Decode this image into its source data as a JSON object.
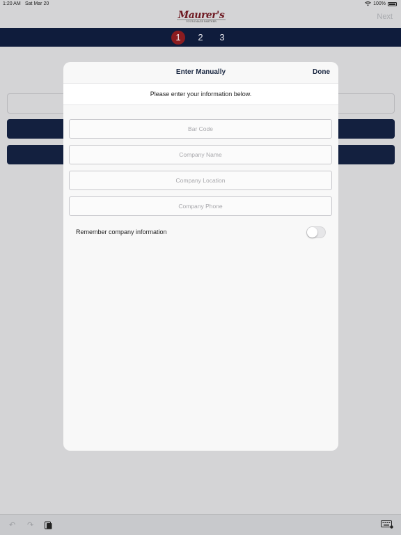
{
  "status_bar": {
    "time": "1:20 AM",
    "date": "Sat Mar 20",
    "battery": "100%"
  },
  "nav": {
    "logo_text": "Maurer's",
    "logo_tagline": "YOUR IMAGE PARTNER",
    "next_label": "Next"
  },
  "steps": [
    {
      "label": "1",
      "active": true
    },
    {
      "label": "2",
      "active": false
    },
    {
      "label": "3",
      "active": false
    }
  ],
  "modal": {
    "title": "Enter Manually",
    "done_label": "Done",
    "instructions": "Please enter your information below.",
    "fields": [
      {
        "placeholder": "Bar Code",
        "value": ""
      },
      {
        "placeholder": "Company Name",
        "value": ""
      },
      {
        "placeholder": "Company Location",
        "value": ""
      },
      {
        "placeholder": "Company Phone",
        "value": ""
      }
    ],
    "remember_label": "Remember company information",
    "remember_on": false
  },
  "icons": {
    "undo": "undo-icon",
    "redo": "redo-icon",
    "paste": "paste-icon",
    "keyboard": "keyboard-icon",
    "wifi": "wifi-icon"
  },
  "colors": {
    "primary_navy": "#0f1c3c",
    "active_step": "#8b1c20",
    "logo": "#6e1a22"
  }
}
